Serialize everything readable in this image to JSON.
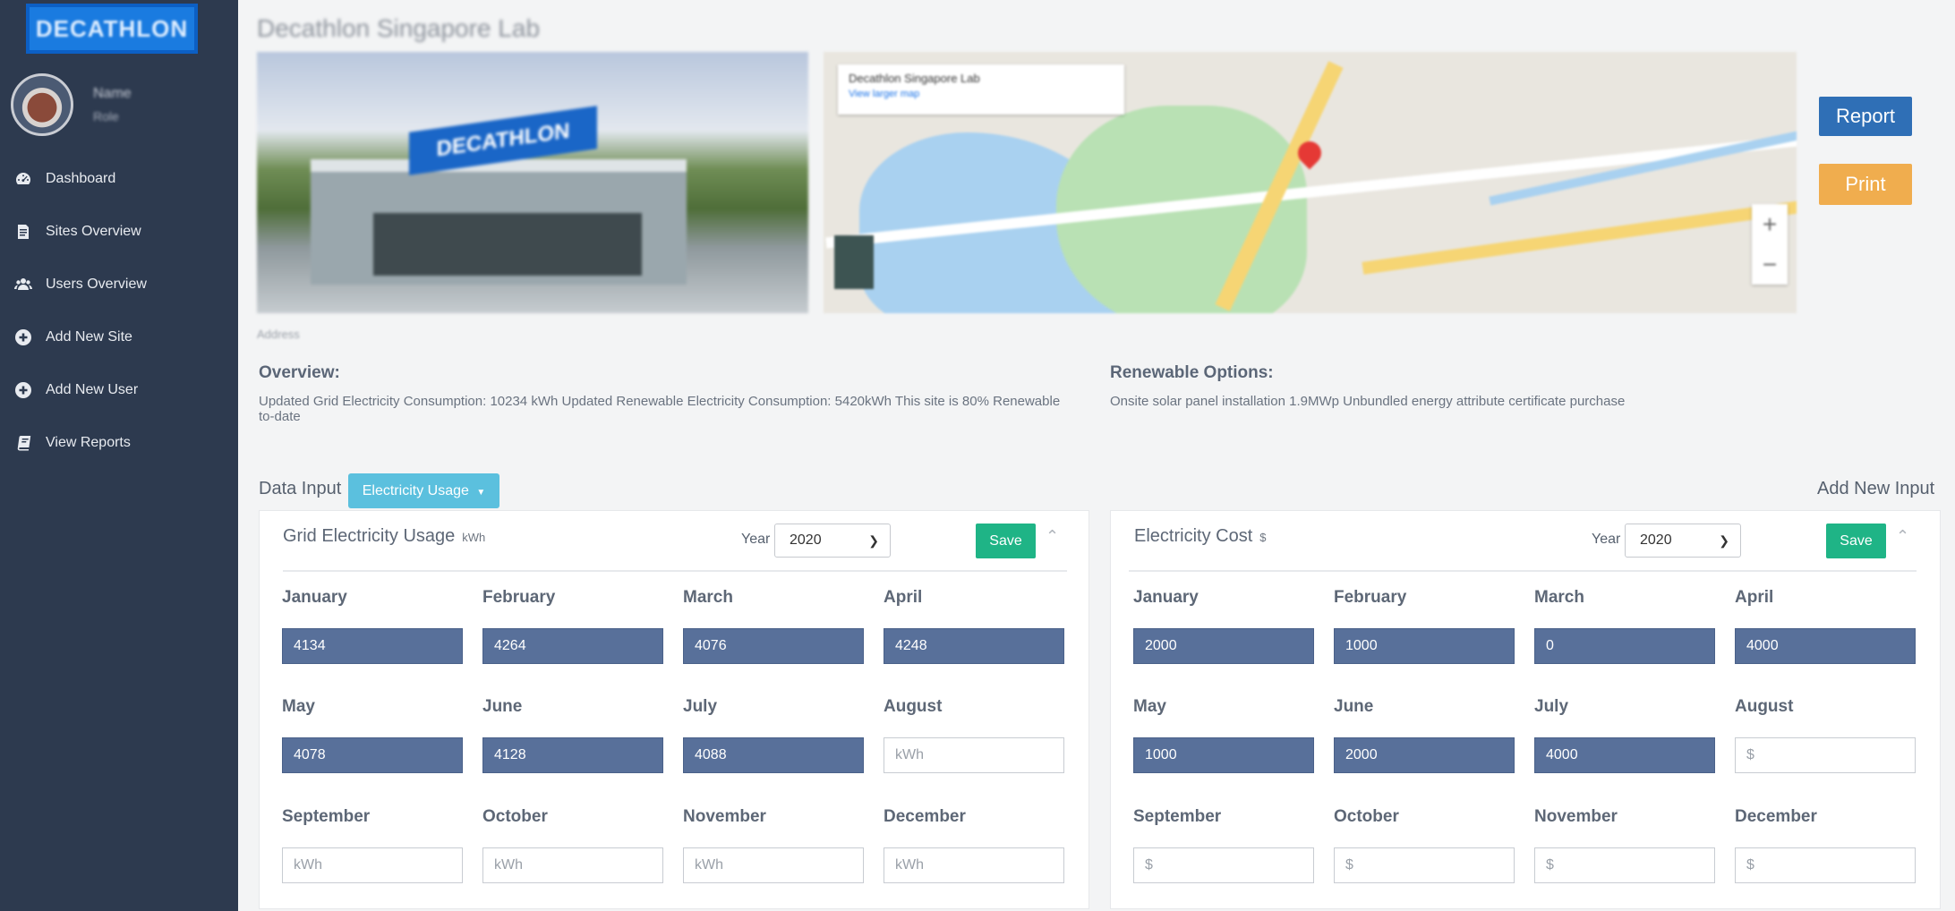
{
  "sidebar": {
    "logo_text": "DECATHLON",
    "profile": {
      "name": "Name",
      "role": "Role"
    },
    "items": [
      {
        "label": "Dashboard",
        "icon": "dashboard-icon"
      },
      {
        "label": "Sites Overview",
        "icon": "document-icon"
      },
      {
        "label": "Users Overview",
        "icon": "users-icon"
      },
      {
        "label": "Add New Site",
        "icon": "plus-circle-icon"
      },
      {
        "label": "Add New User",
        "icon": "plus-circle-icon"
      },
      {
        "label": "View Reports",
        "icon": "book-icon"
      }
    ]
  },
  "site": {
    "title": "Decathlon Singapore Lab",
    "address": "Address"
  },
  "map": {
    "infobox_title": "Decathlon Singapore Lab",
    "infobox_link": "View larger map"
  },
  "actions": {
    "report": "Report",
    "print": "Print"
  },
  "overview": {
    "title": "Overview:",
    "text": "Updated Grid Electricity Consumption: 10234 kWh Updated Renewable Electricity Consumption: 5420kWh This site is 80% Renewable to-date"
  },
  "renewable": {
    "title": "Renewable Options:",
    "text": "Onsite solar panel installation 1.9MWp Unbundled energy attribute certificate purchase"
  },
  "data_input": {
    "label": "Data Input",
    "dropdown": "Electricity Usage",
    "add_new": "Add New Input"
  },
  "panels": [
    {
      "title": "Grid Electricity Usage",
      "unit": "kWh",
      "year_label": "Year",
      "year": "2020",
      "save": "Save",
      "placeholder": "kWh",
      "months": [
        {
          "name": "January",
          "value": "4134"
        },
        {
          "name": "February",
          "value": "4264"
        },
        {
          "name": "March",
          "value": "4076"
        },
        {
          "name": "April",
          "value": "4248"
        },
        {
          "name": "May",
          "value": "4078"
        },
        {
          "name": "June",
          "value": "4128"
        },
        {
          "name": "July",
          "value": "4088"
        },
        {
          "name": "August",
          "value": ""
        },
        {
          "name": "September",
          "value": ""
        },
        {
          "name": "October",
          "value": ""
        },
        {
          "name": "November",
          "value": ""
        },
        {
          "name": "December",
          "value": ""
        }
      ]
    },
    {
      "title": "Electricity Cost",
      "unit": "$",
      "year_label": "Year",
      "year": "2020",
      "save": "Save",
      "placeholder": "$",
      "months": [
        {
          "name": "January",
          "value": "2000"
        },
        {
          "name": "February",
          "value": "1000"
        },
        {
          "name": "March",
          "value": "0"
        },
        {
          "name": "April",
          "value": "4000"
        },
        {
          "name": "May",
          "value": "1000"
        },
        {
          "name": "June",
          "value": "2000"
        },
        {
          "name": "July",
          "value": "4000"
        },
        {
          "name": "August",
          "value": ""
        },
        {
          "name": "September",
          "value": ""
        },
        {
          "name": "October",
          "value": ""
        },
        {
          "name": "November",
          "value": ""
        },
        {
          "name": "December",
          "value": ""
        }
      ]
    }
  ],
  "colors": {
    "sidebar_bg": "#2d3a4f",
    "filled_input": "#58709a",
    "save_button": "#1fb486",
    "report_button": "#2f6fb6",
    "print_button": "#f0ad4e",
    "dropdown_button": "#5bc0de"
  }
}
